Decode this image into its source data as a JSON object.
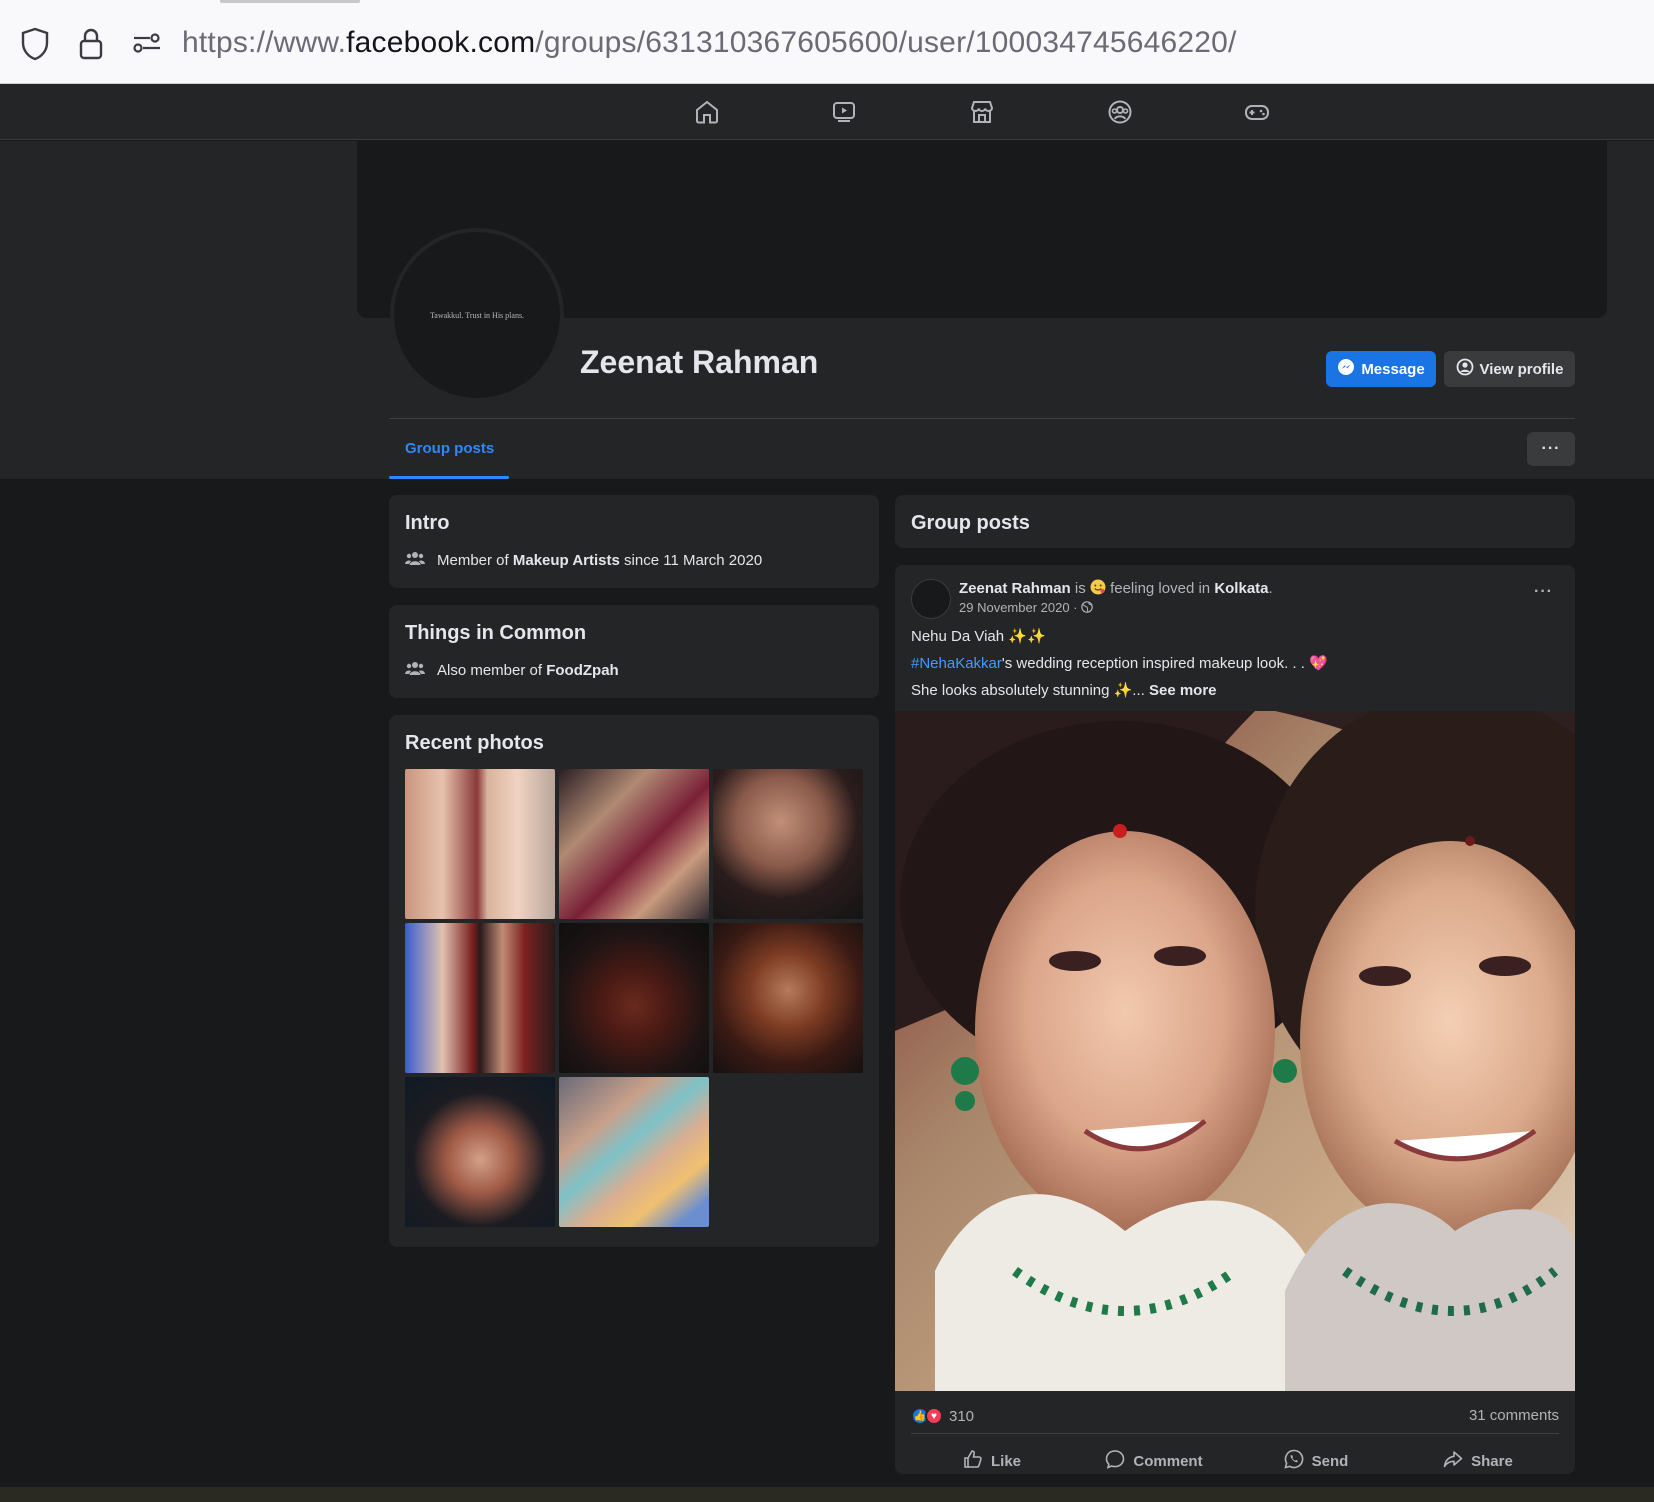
{
  "browser": {
    "url_prefix": "https://www.",
    "url_host": "facebook.com",
    "url_path": "/groups/631310367605600/user/100034745646220/",
    "icons": [
      "shield-icon",
      "lock-icon",
      "permissions-icon"
    ]
  },
  "nav": {
    "icons": [
      "home-icon",
      "watch-icon",
      "marketplace-icon",
      "groups-icon",
      "gaming-icon"
    ]
  },
  "profile": {
    "avatar_text": "Tawakkul. Trust in His plans.",
    "name": "Zeenat Rahman",
    "message_label": "Message",
    "view_profile_label": "View profile",
    "tab_label": "Group posts",
    "more_label": "···"
  },
  "intro": {
    "title": "Intro",
    "prefix": "Member of",
    "group": "Makeup Artists",
    "suffix": "since 11 March 2020"
  },
  "common": {
    "title": "Things in Common",
    "prefix": "Also member of",
    "group": "FoodZpah"
  },
  "photos": {
    "title": "Recent photos"
  },
  "group_posts": {
    "title": "Group posts"
  },
  "post": {
    "author": "Zeenat Rahman",
    "is": "is",
    "feeling": "feeling loved in",
    "location": "Kolkata",
    "date": "29 November 2020 ·",
    "line1": "Nehu Da Viah ✨✨",
    "hashtag": "#NehaKakkar",
    "line2_rest": "'s wedding reception inspired makeup look. . . 💖",
    "line3": "She looks absolutely stunning ✨...",
    "see_more": "See more",
    "reactions_count": "310",
    "comments": "31 comments",
    "like": "Like",
    "comment": "Comment",
    "send": "Send",
    "share": "Share"
  },
  "colors": {
    "accent": "#1b74e4",
    "link": "#2d88ff",
    "background": "#18191a",
    "surface": "#242526"
  }
}
